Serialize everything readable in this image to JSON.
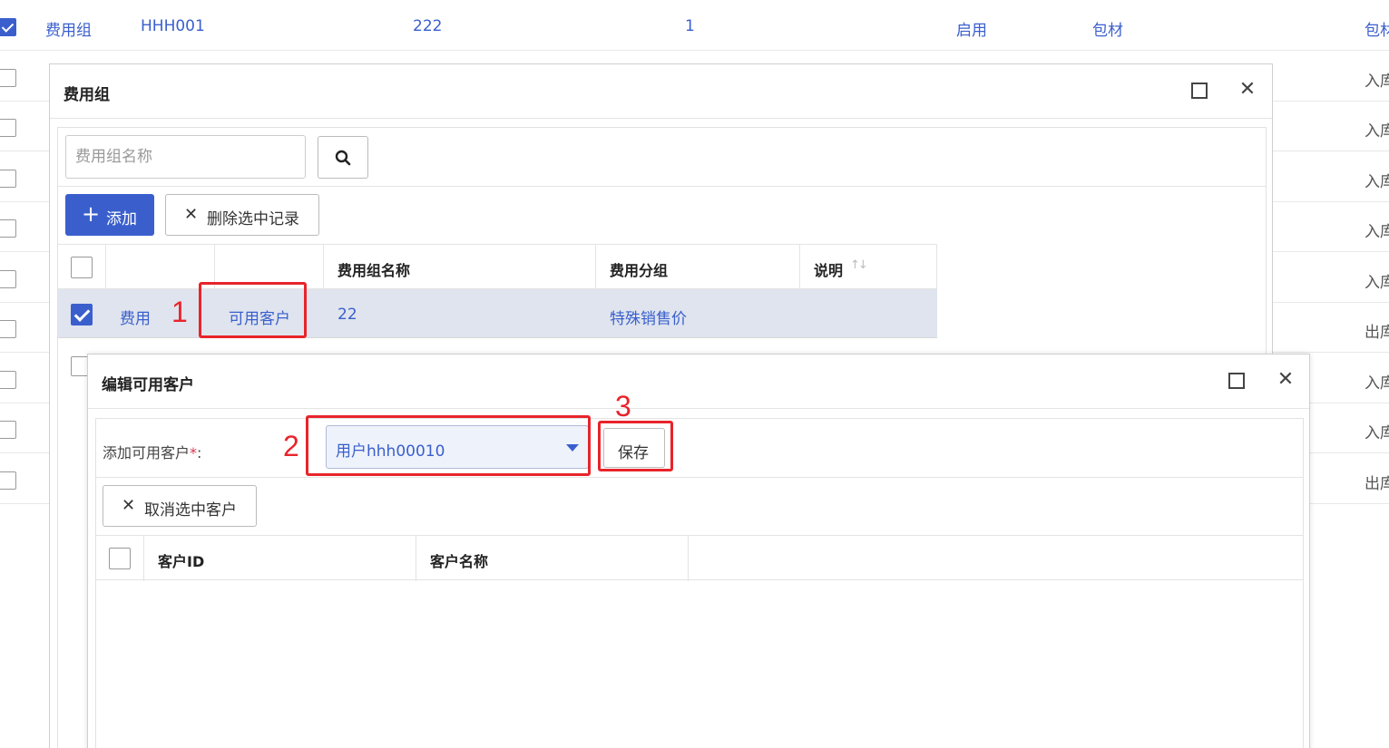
{
  "background_table": {
    "first_row": {
      "col1": "费用组",
      "col2": "HHH001",
      "col3": "222",
      "col4": "1",
      "col5": "启用",
      "col6": "包材",
      "col7": "包材"
    },
    "right_col_values": [
      "入库",
      "入库",
      "入库",
      "入库",
      "入库",
      "出库",
      "入库",
      "入库",
      "出库"
    ]
  },
  "dialog_fee_group": {
    "title": "费用组",
    "search": {
      "placeholder": "费用组名称",
      "icon": "search-icon"
    },
    "toolbar": {
      "add_label": "添加",
      "delete_label": "删除选中记录"
    },
    "columns": [
      "费用组名称",
      "费用分组",
      "说明"
    ],
    "rows": [
      {
        "action1": "费用",
        "action2": "可用客户",
        "name": "22",
        "group": "特殊销售价",
        "description": ""
      }
    ]
  },
  "dialog_edit_customers": {
    "title": "编辑可用客户",
    "field_label": "添加可用客户",
    "required_mark": "*",
    "field_colon": ":",
    "selected_customer": "用户hhh00010",
    "save_label": "保存",
    "cancel_label": "取消选中客户",
    "columns": [
      "客户ID",
      "客户名称"
    ]
  },
  "annotations": [
    "1",
    "2",
    "3"
  ],
  "colors": {
    "accent": "#3a5fcd",
    "annotation": "#e8242b",
    "required": "#d9364a"
  }
}
